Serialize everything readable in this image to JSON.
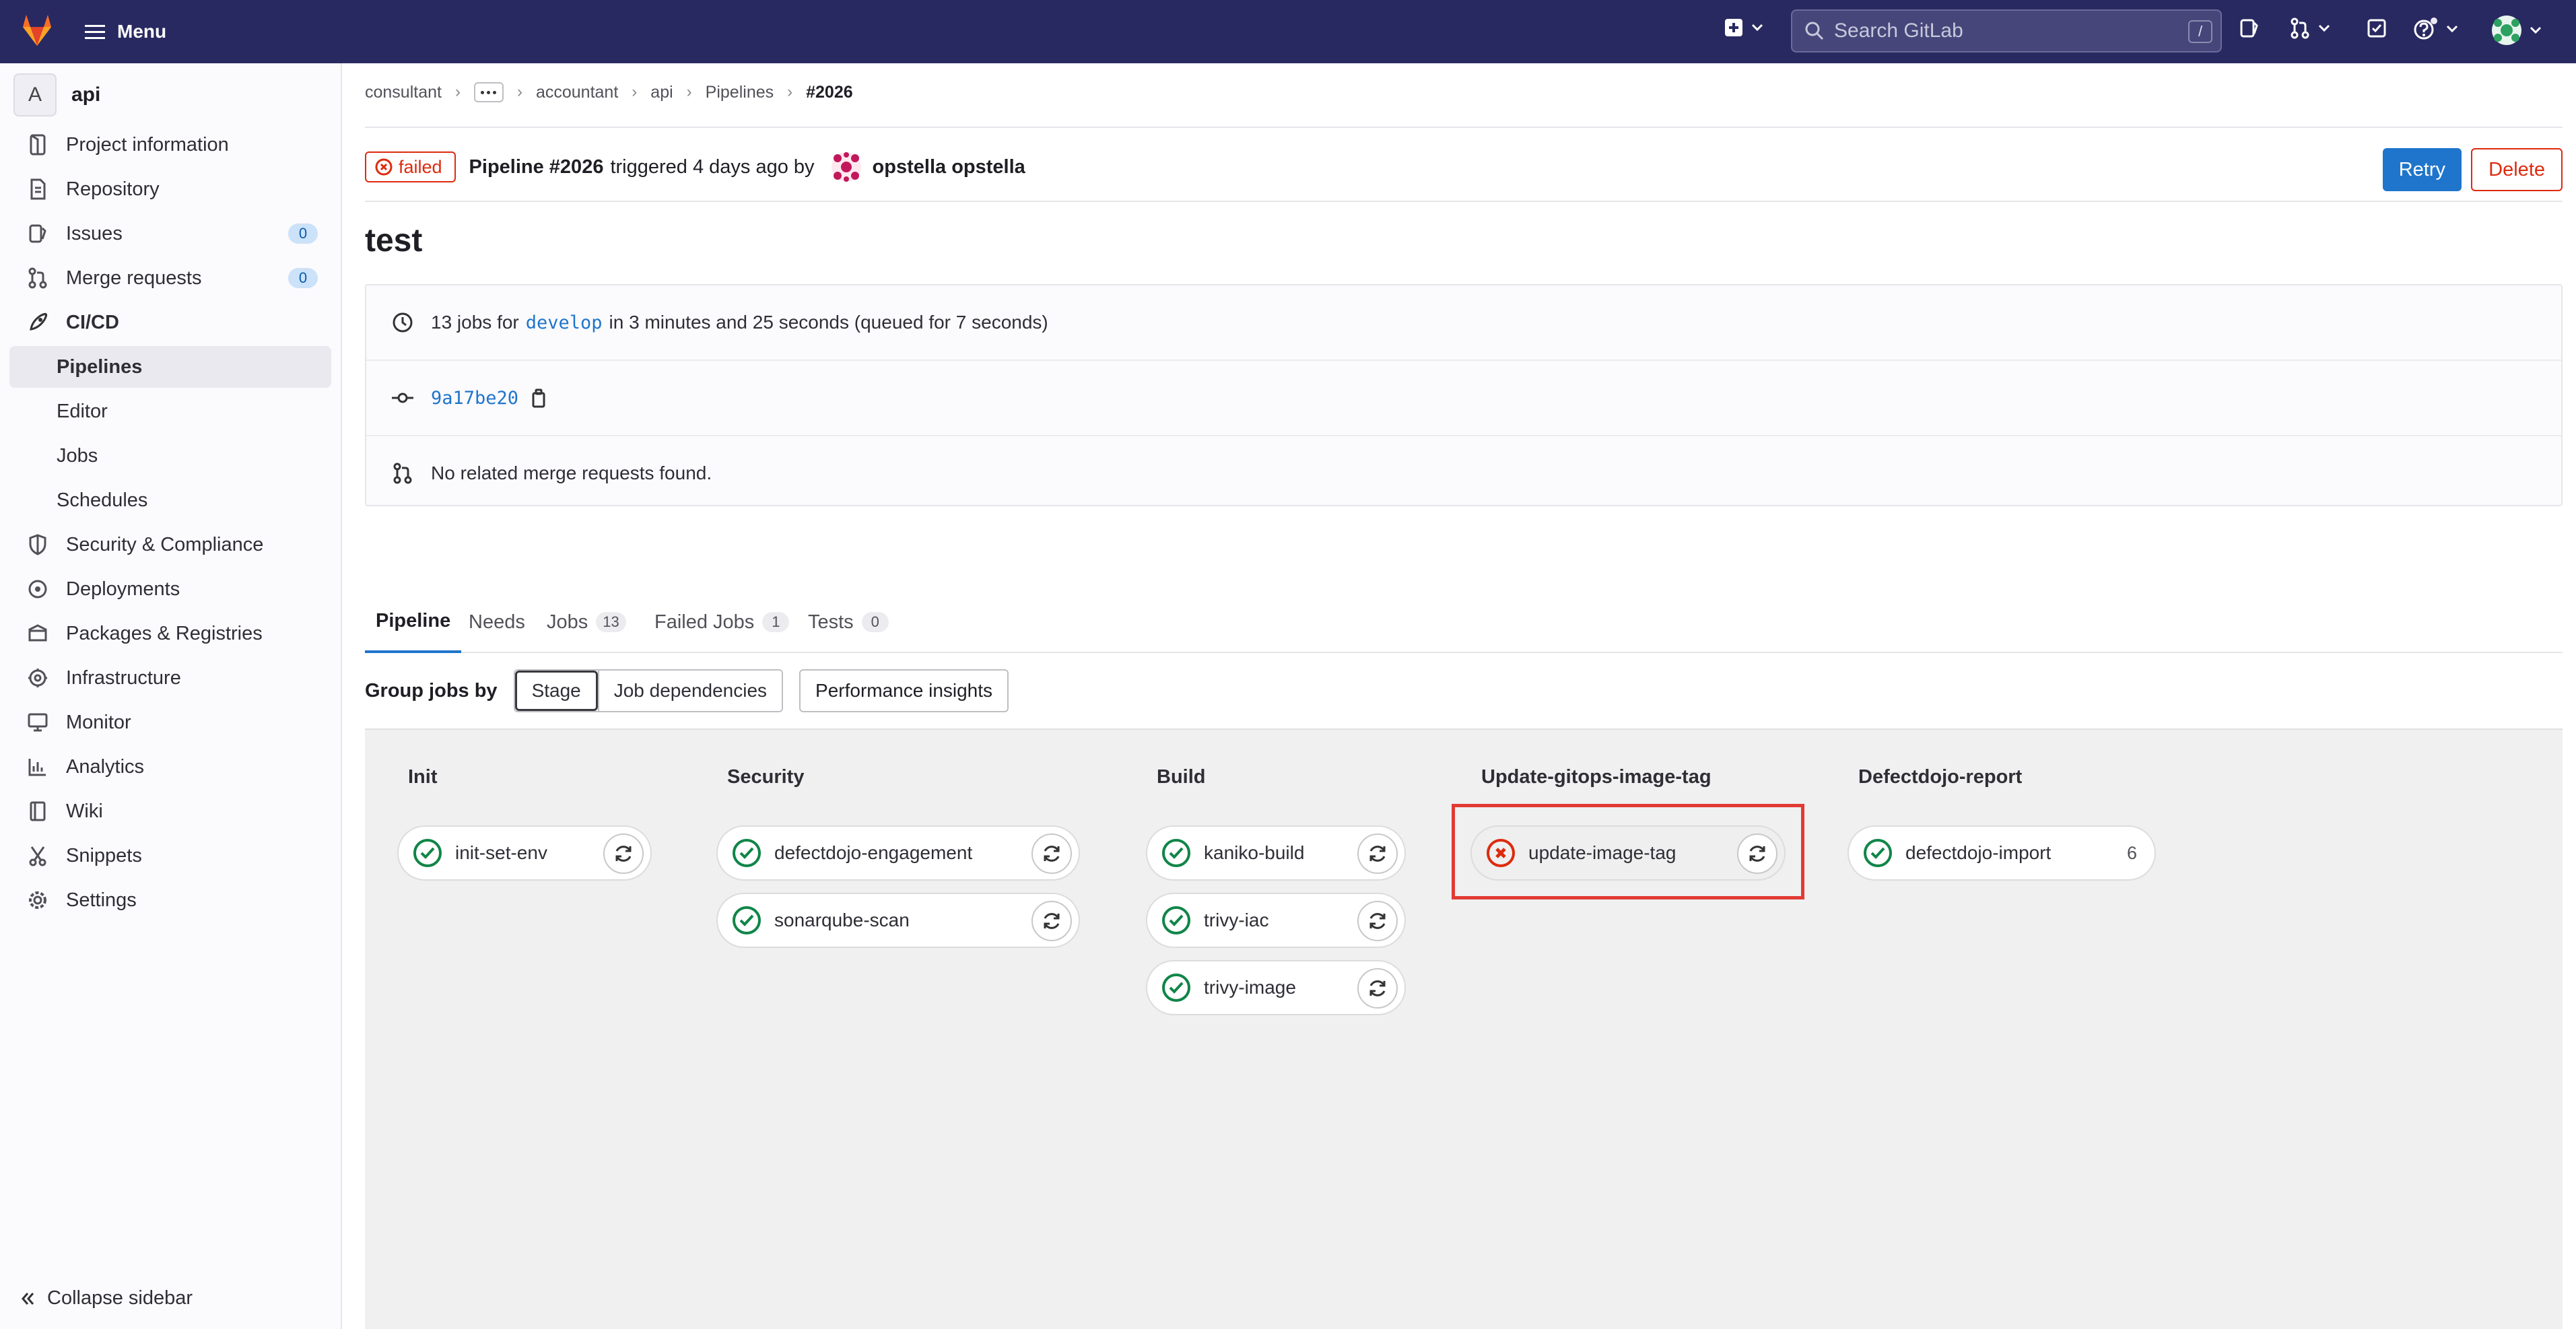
{
  "topbar": {
    "menu_label": "Menu",
    "search_placeholder": "Search GitLab",
    "search_shortcut": "/"
  },
  "sidebar": {
    "project_initial": "A",
    "project_name": "api",
    "items": [
      {
        "label": "Project information",
        "icon": "info-icon"
      },
      {
        "label": "Repository",
        "icon": "doc-icon"
      },
      {
        "label": "Issues",
        "icon": "issues-icon",
        "count": "0"
      },
      {
        "label": "Merge requests",
        "icon": "merge-request-icon",
        "count": "0"
      },
      {
        "label": "CI/CD",
        "icon": "rocket-icon"
      },
      {
        "label": "Pipelines"
      },
      {
        "label": "Editor"
      },
      {
        "label": "Jobs"
      },
      {
        "label": "Schedules"
      },
      {
        "label": "Security & Compliance",
        "icon": "shield-icon"
      },
      {
        "label": "Deployments",
        "icon": "deployments-icon"
      },
      {
        "label": "Packages & Registries",
        "icon": "package-icon"
      },
      {
        "label": "Infrastructure",
        "icon": "cloud-gear-icon"
      },
      {
        "label": "Monitor",
        "icon": "monitor-icon"
      },
      {
        "label": "Analytics",
        "icon": "chart-icon"
      },
      {
        "label": "Wiki",
        "icon": "book-icon"
      },
      {
        "label": "Snippets",
        "icon": "snippet-icon"
      },
      {
        "label": "Settings",
        "icon": "gear-icon"
      }
    ],
    "collapse_label": "Collapse sidebar"
  },
  "breadcrumb": [
    "consultant",
    "accountant",
    "api",
    "Pipelines",
    "#2026"
  ],
  "pipeline": {
    "status": "failed",
    "title": "Pipeline #2026",
    "triggered_text": "triggered 4 days ago by",
    "user": "opstella opstella",
    "retry_label": "Retry",
    "delete_label": "Delete",
    "name": "test",
    "jobs_count_text": "13 jobs for",
    "branch": "develop",
    "duration_text": "in 3 minutes and 25 seconds (queued for 7 seconds)",
    "commit": "9a17be20",
    "mr_text": "No related merge requests found."
  },
  "tabs": [
    {
      "label": "Pipeline"
    },
    {
      "label": "Needs"
    },
    {
      "label": "Jobs",
      "count": "13"
    },
    {
      "label": "Failed Jobs",
      "count": "1"
    },
    {
      "label": "Tests",
      "count": "0"
    }
  ],
  "group_by": {
    "label": "Group jobs by",
    "options": [
      "Stage",
      "Job dependencies"
    ],
    "selected": "Stage",
    "perf_label": "Performance insights"
  },
  "stages": [
    {
      "name": "Init",
      "jobs": [
        {
          "name": "init-set-env",
          "status": "success"
        }
      ]
    },
    {
      "name": "Security",
      "jobs": [
        {
          "name": "defectdojo-engagement",
          "status": "success"
        },
        {
          "name": "sonarqube-scan",
          "status": "success"
        }
      ]
    },
    {
      "name": "Build",
      "jobs": [
        {
          "name": "kaniko-build",
          "status": "success"
        },
        {
          "name": "trivy-iac",
          "status": "success"
        },
        {
          "name": "trivy-image",
          "status": "success"
        }
      ]
    },
    {
      "name": "Update-gitops-image-tag",
      "jobs": [
        {
          "name": "update-image-tag",
          "status": "failed"
        }
      ]
    },
    {
      "name": "Defectdojo-report",
      "jobs": [
        {
          "name": "defectdojo-import",
          "status": "success",
          "count": "6"
        }
      ]
    }
  ],
  "colors": {
    "topbar": "#292961",
    "success": "#108548",
    "failed": "#dd2b0e",
    "primary": "#1f75cb",
    "highlight": "#e23a34"
  }
}
